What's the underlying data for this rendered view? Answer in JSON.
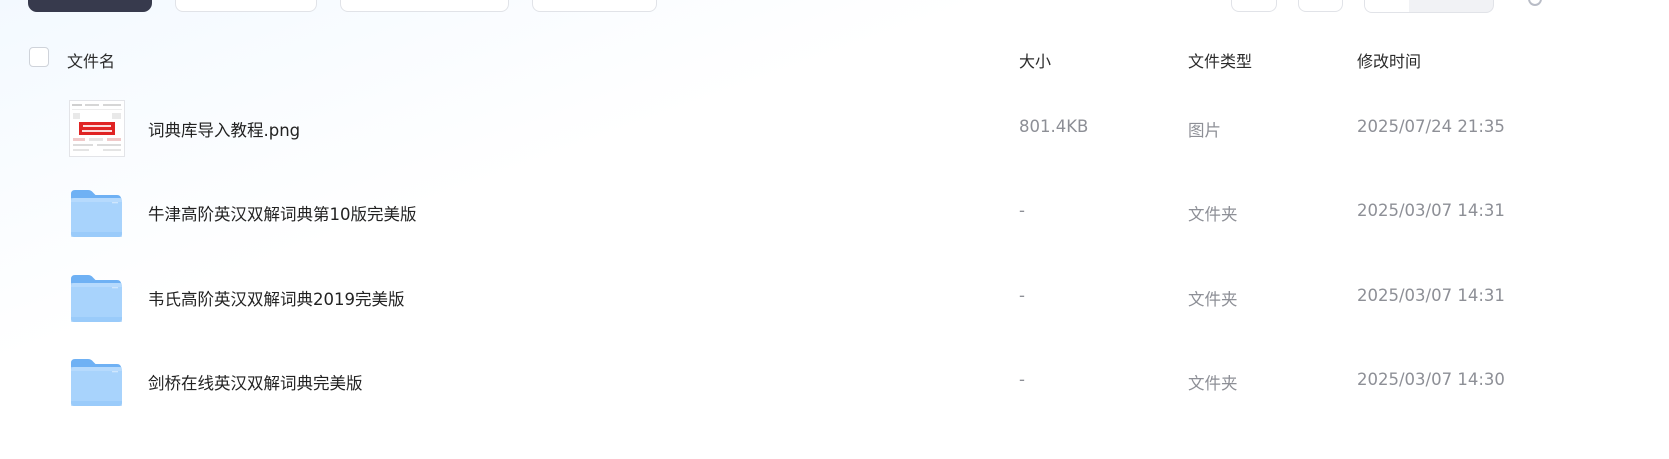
{
  "header": {
    "name_label": "文件名",
    "size_label": "大小",
    "type_label": "文件类型",
    "time_label": "修改时间"
  },
  "files": [
    {
      "icon": "image-thumbnail-icon",
      "name": "词典库导入教程.png",
      "size": "801.4KB",
      "type": "图片",
      "modified": "2025/07/24 21:35"
    },
    {
      "icon": "folder-icon",
      "name": "牛津高阶英汉双解词典第10版完美版",
      "size": "-",
      "type": "文件夹",
      "modified": "2025/03/07 14:31"
    },
    {
      "icon": "folder-icon",
      "name": "韦氏高阶英汉双解词典2019完美版",
      "size": "-",
      "type": "文件夹",
      "modified": "2025/03/07 14:31"
    },
    {
      "icon": "folder-icon",
      "name": "剑桥在线英汉双解词典完美版",
      "size": "-",
      "type": "文件夹",
      "modified": "2025/03/07 14:30"
    }
  ],
  "colors": {
    "folder": "#8cc3f8",
    "primary_button": "#373a4d",
    "muted_text": "#8d8f96"
  }
}
